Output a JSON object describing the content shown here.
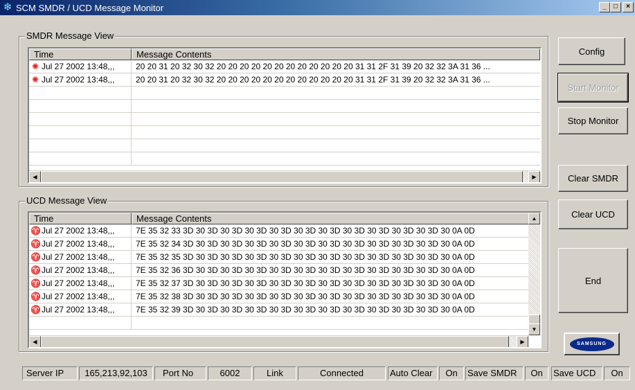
{
  "window": {
    "title": "SCM SMDR / UCD Message Monitor",
    "minimize": "_",
    "maximize": "□",
    "close": "×"
  },
  "smdr": {
    "group_title": "SMDR Message View",
    "col_time": "Time",
    "col_message": "Message Contents",
    "rows": [
      {
        "time": "Jul 27 2002 13:48,,,",
        "message": "20 20 31 20 32 30 32 20 20 20 20 20 20 20 20 20 20 20 20 31 31 2F 31 39 20 32 32 3A 31 36 ..."
      },
      {
        "time": "Jul 27 2002 13:48,,,",
        "message": "20 20 31 20 32 30 32 20 20 20 20 20 20 20 20 20 20 20 20 31 31 2F 31 39 20 32 32 3A 31 36 ..."
      }
    ]
  },
  "ucd": {
    "group_title": "UCD Message View",
    "col_time": "Time",
    "col_message": "Message Contents",
    "rows": [
      {
        "time": "Jul 27 2002 13:48,,,",
        "message": "7E 35 32 33 3D 30 3D 30 3D 30 3D 30 3D 30 3D 30 3D 30 3D 30 3D 30 3D 30 3D 30 0A 0D"
      },
      {
        "time": "Jul 27 2002 13:48,,,",
        "message": "7E 35 32 34 3D 30 3D 30 3D 30 3D 30 3D 30 3D 30 3D 30 3D 30 3D 30 3D 30 3D 30 0A 0D"
      },
      {
        "time": "Jul 27 2002 13:48,,,",
        "message": "7E 35 32 35 3D 30 3D 30 3D 30 3D 30 3D 30 3D 30 3D 30 3D 30 3D 30 3D 30 3D 30 0A 0D"
      },
      {
        "time": "Jul 27 2002 13:48,,,",
        "message": "7E 35 32 36 3D 30 3D 30 3D 30 3D 30 3D 30 3D 30 3D 30 3D 30 3D 30 3D 30 3D 30 0A 0D"
      },
      {
        "time": "Jul 27 2002 13:48,,,",
        "message": "7E 35 32 37 3D 30 3D 30 3D 30 3D 30 3D 30 3D 30 3D 30 3D 30 3D 30 3D 30 3D 30 0A 0D"
      },
      {
        "time": "Jul 27 2002 13:48,,,",
        "message": "7E 35 32 38 3D 30 3D 30 3D 30 3D 30 3D 30 3D 30 3D 30 3D 30 3D 30 3D 30 3D 30 0A 0D"
      },
      {
        "time": "Jul 27 2002 13:48,,,",
        "message": "7E 35 32 39 3D 30 3D 30 3D 30 3D 30 3D 30 3D 30 3D 30 3D 30 3D 30 3D 30 3D 30 0A 0D"
      }
    ]
  },
  "buttons": {
    "config": "Config",
    "start_monitor": "Start Monitor",
    "stop_monitor": "Stop Monitor",
    "clear_smdr": "Clear SMDR",
    "clear_ucd": "Clear UCD",
    "end": "End"
  },
  "logo": {
    "text": "SAMSUNG"
  },
  "status": {
    "server_ip_label": "Server IP",
    "server_ip_value": "165,213,92,103",
    "port_label": "Port No",
    "port_value": "6002",
    "link_label": "Link",
    "link_value": "Connected",
    "auto_clear_label": "Auto Clear",
    "auto_clear_value": "On",
    "save_smdr_label": "Save SMDR",
    "save_smdr_value": "On",
    "save_ucd_label": "Save UCD",
    "save_ucd_value": "On"
  },
  "icons": {
    "app": "snowflake-icon",
    "smdr_row": "sun-icon",
    "ucd_row": "lightbulb-icon"
  }
}
